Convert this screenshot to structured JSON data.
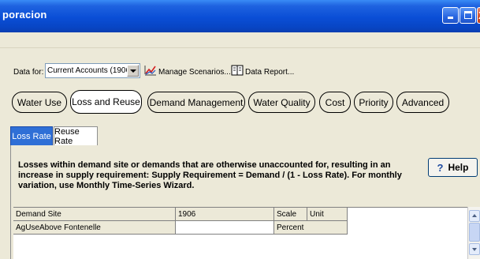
{
  "window": {
    "title": "poracion"
  },
  "toolbar": {
    "data_for_label": "Data for:",
    "data_for_value": "Current Accounts (1906)",
    "manage_scenarios": "Manage Scenarios...",
    "data_report": "Data Report..."
  },
  "main_tabs": [
    {
      "label": "Water Use"
    },
    {
      "label": "Loss and Reuse"
    },
    {
      "label": "Demand Management"
    },
    {
      "label": "Water Quality"
    },
    {
      "label": "Cost"
    },
    {
      "label": "Priority"
    },
    {
      "label": "Advanced"
    }
  ],
  "sub_tabs": [
    {
      "label": "Loss Rate"
    },
    {
      "label": "Reuse Rate"
    }
  ],
  "description": "Losses within demand site or demands that are otherwise unaccounted for, resulting in an increase in supply requirement:  Supply Requirement = Demand / (1 - Loss Rate).  For monthly variation, use Monthly Time-Series Wizard.",
  "help": {
    "label": "Help"
  },
  "grid": {
    "headers": [
      "Demand Site",
      "1906",
      "Scale",
      "Unit"
    ],
    "rows": [
      {
        "site": "AgUseAbove Fontenelle",
        "value": "",
        "scale": "Percent",
        "unit": ""
      }
    ]
  }
}
